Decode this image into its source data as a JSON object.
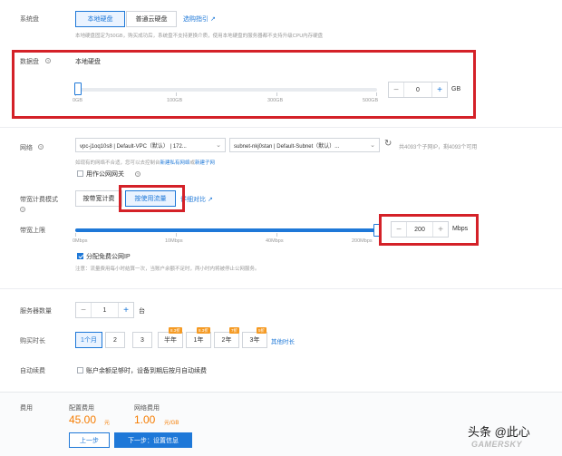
{
  "system_disk": {
    "label": "系统盘",
    "options": [
      "本地硬盘",
      "普通云硬盘"
    ],
    "selected": "本地硬盘",
    "guide_link": "选购指引",
    "note": "本地硬盘固定为50GB，购买成功后，系统盘不支持更换介质，使用本地硬盘的服务器都不支持升级CPU内存硬盘"
  },
  "data_disk": {
    "label": "数据盘",
    "type_label": "本地硬盘",
    "ticks": [
      "0GB",
      "100GB",
      "300GB",
      "500GB"
    ],
    "value": "0",
    "unit": "GB",
    "minus": "−",
    "plus": "+",
    "level": 0
  },
  "network": {
    "label": "网络",
    "vpc_select": "vpc-j1oq10s8 | Default-VPC（默认） | 172...",
    "subnet_select": "subnet-nkj0stan | Default-Subnet（默认）...",
    "ip_info": "共4093个子网IP，剩4093个可用",
    "hint_prefix": "如现有的网络不合适，您可以去控制台",
    "hint_link_vpc": "新建私有网络",
    "hint_or": "或",
    "hint_link_subnet": "新建子网",
    "gateway_label": "用作公网网关",
    "refresh_icon": "↻"
  },
  "billing": {
    "label": "带宽计费模式",
    "options": [
      "按带宽计费",
      "按使用流量"
    ],
    "selected": "按使用流量",
    "compare_link": "详细对比"
  },
  "bandwidth": {
    "label": "带宽上限",
    "ticks": [
      "0Mbps",
      "10Mbps",
      "40Mbps",
      "200Mbps"
    ],
    "value": "200",
    "unit": "Mbps",
    "minus": "−",
    "plus": "+",
    "level": 1,
    "free_ip_label": "分配免费公网IP",
    "note": "注意：流量费用每小时结算一次，当账户余额不足时，两小时内将被停止公网服务。"
  },
  "server_count": {
    "label": "服务器数量",
    "value": "1",
    "unit": "台",
    "minus": "−",
    "plus": "+"
  },
  "duration": {
    "label": "购买时长",
    "options": [
      "1个月",
      "2",
      "3",
      "半年",
      "1年",
      "2年",
      "3年"
    ],
    "selected": "1个月",
    "badges": [
      "8.3折",
      "8.3折",
      "7折",
      "5折"
    ],
    "more_link": "其他时长"
  },
  "auto_renew": {
    "label": "自动续费",
    "text": "账户余额足够时，设备到期后按月自动续费"
  },
  "fee": {
    "label": "费用",
    "config_label": "配置费用",
    "config_value": "45.00",
    "config_unit": "元",
    "network_label": "网络费用",
    "network_value": "1.00",
    "network_unit": "元/GB",
    "prev_button": "上一步",
    "next_button": "下一步：设置信息"
  },
  "watermark": {
    "author": "头条 @此心",
    "site": "GAMERSKY"
  },
  "colors": {
    "accent": "#1e78d8",
    "highlight_box": "#d42128",
    "price": "#f57c00",
    "badge": "#f59a23"
  }
}
